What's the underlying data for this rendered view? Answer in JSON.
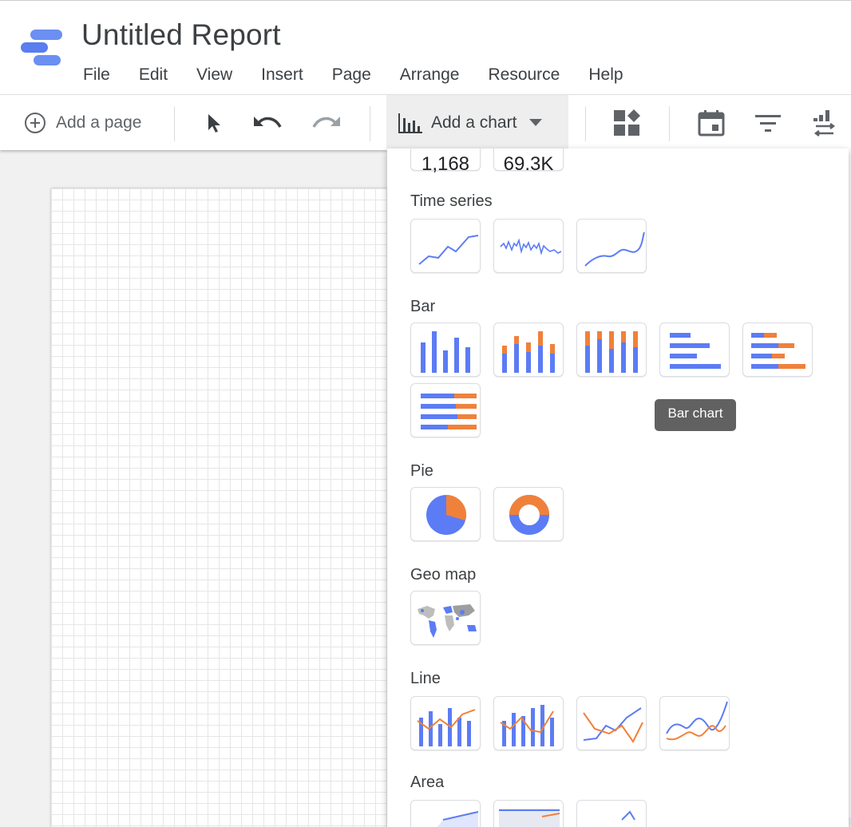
{
  "app": {
    "title": "Untitled Report",
    "menu": [
      "File",
      "Edit",
      "View",
      "Insert",
      "Page",
      "Arrange",
      "Resource",
      "Help"
    ]
  },
  "toolbar": {
    "add_page_label": "Add a page",
    "add_chart_label": "Add a chart"
  },
  "chart_menu": {
    "scorecards": [
      "1,168",
      "69.3K"
    ],
    "sections": {
      "time_series": "Time series",
      "bar": "Bar",
      "pie": "Pie",
      "geo_map": "Geo map",
      "line": "Line",
      "area": "Area"
    },
    "tooltip": "Bar chart"
  },
  "colors": {
    "series_blue": "#5c7cf5",
    "series_orange": "#f0813a",
    "tooltip_bg": "#616161",
    "logo_blue": "#6b8ff2"
  }
}
